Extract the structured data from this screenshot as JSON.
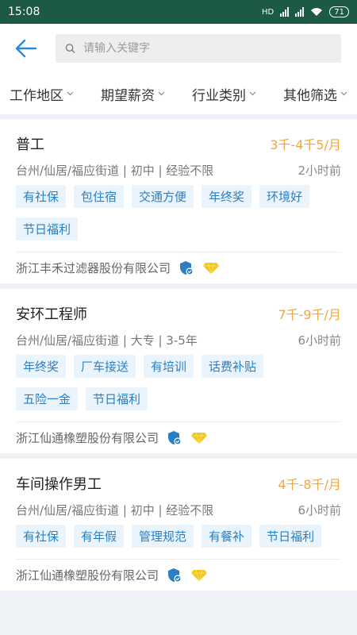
{
  "status": {
    "time": "15:08",
    "network": "HD",
    "battery": "71"
  },
  "search": {
    "placeholder": "请输入关键字"
  },
  "filters": [
    "工作地区",
    "期望薪资",
    "行业类别",
    "其他筛选"
  ],
  "jobs": [
    {
      "title": "普工",
      "salary": "3千-4千5/月",
      "meta": "台州/仙居/福应街道 | 初中 | 经验不限",
      "time": "2小时前",
      "tags": [
        "有社保",
        "包住宿",
        "交通方便",
        "年终奖",
        "环境好",
        "节日福利"
      ],
      "company": "浙江丰禾过滤器股份有限公司"
    },
    {
      "title": "安环工程师",
      "salary": "7千-9千/月",
      "meta": "台州/仙居/福应街道 | 大专 | 3-5年",
      "time": "6小时前",
      "tags": [
        "年终奖",
        "厂车接送",
        "有培训",
        "话费补贴",
        "五险一金",
        "节日福利"
      ],
      "company": "浙江仙通橡塑股份有限公司"
    },
    {
      "title": "车间操作男工",
      "salary": "4千-8千/月",
      "meta": "台州/仙居/福应街道 | 初中 | 经验不限",
      "time": "6小时前",
      "tags": [
        "有社保",
        "有年假",
        "管理规范",
        "有餐补",
        "节日福利"
      ],
      "company": "浙江仙通橡塑股份有限公司"
    }
  ]
}
